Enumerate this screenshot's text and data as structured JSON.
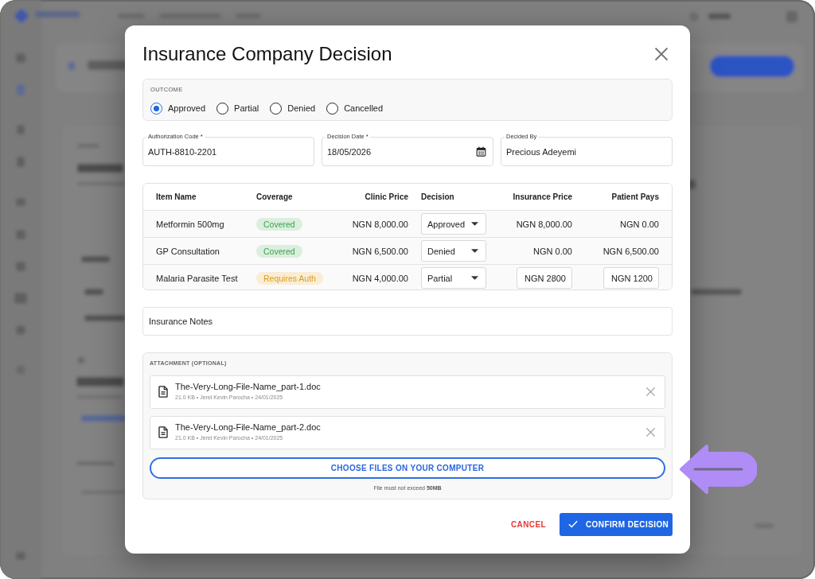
{
  "dialog": {
    "title": "Insurance Company Decision"
  },
  "outcome": {
    "label": "OUTCOME",
    "options": [
      {
        "label": "Approved",
        "selected": true
      },
      {
        "label": "Partial",
        "selected": false
      },
      {
        "label": "Denied",
        "selected": false
      },
      {
        "label": "Cancelled",
        "selected": false
      }
    ]
  },
  "fields": [
    {
      "kind": "text",
      "label": "Authorization Code *",
      "value": "AUTH-8810-2201"
    },
    {
      "kind": "date",
      "label": "Decision Date *",
      "value": "18/05/2026"
    },
    {
      "kind": "text",
      "label": "Decided By",
      "value": "Precious Adeyemi"
    }
  ],
  "table": {
    "columns": [
      "Item Name",
      "Coverage",
      "Clinic Price",
      "Decision",
      "Insurance Price",
      "Patient Pays"
    ],
    "rows": [
      {
        "item": "Metformin 500mg",
        "coverage": {
          "label": "Covered",
          "color": "#3ba34b"
        },
        "clinic_price": "NGN 8,000.00",
        "decision": "Approved",
        "insurance_price": "NGN 8,000.00",
        "patient_pays": "NGN 0.00",
        "editable": false
      },
      {
        "item": "GP Consultation",
        "coverage": {
          "label": "Covered",
          "color": "#3ba34b"
        },
        "clinic_price": "NGN 6,500.00",
        "decision": "Denied",
        "insurance_price": "NGN 0.00",
        "patient_pays": "NGN 6,500.00",
        "editable": false
      },
      {
        "item": "Malaria Parasite Test",
        "coverage": {
          "label": "Requires Auth",
          "color": "#dd9d16"
        },
        "clinic_price": "NGN 4,000.00",
        "decision": "Partial",
        "insurance_price": "NGN 2800",
        "patient_pays": "NGN 1200",
        "editable": true
      }
    ]
  },
  "notes": {
    "placeholder": "Insurance Notes"
  },
  "attachments": {
    "label": "ATTACHMENT (OPTIONAL)",
    "files": [
      {
        "name": "The-Very-Long-File-Name_part-1.doc",
        "meta": "21.0 KB • Jerel Kevin Parocha • 24/01/2025"
      },
      {
        "name": "The-Very-Long-File-Name_part-2.doc",
        "meta": "21.0 KB • Jerel Kevin Parocha • 24/01/2025"
      }
    ],
    "choose_button": "CHOOSE FILES ON YOUR COMPUTER",
    "hint": "File must not exceed **50MB**"
  },
  "actions": {
    "cancel": "CANCEL",
    "confirm": "CONFIRM DECISION"
  }
}
